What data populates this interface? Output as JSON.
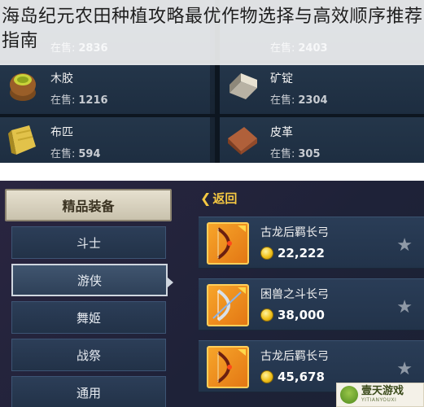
{
  "article": {
    "title": "海岛纪元农田种植攻略最优作物选择与高效顺序推荐指南"
  },
  "materials": {
    "stock_label": "在售:",
    "items": [
      {
        "name": "",
        "stock": "2836",
        "icon": "material-icon"
      },
      {
        "name": "",
        "stock": "2403",
        "icon": "material-icon"
      },
      {
        "name": "木胶",
        "stock": "1216",
        "icon": "wood-glue-icon"
      },
      {
        "name": "矿锭",
        "stock": "2304",
        "icon": "ore-ingot-icon"
      },
      {
        "name": "布匹",
        "stock": "594",
        "icon": "cloth-icon"
      },
      {
        "name": "皮革",
        "stock": "305",
        "icon": "leather-icon"
      }
    ]
  },
  "shop": {
    "category_header": "精品装备",
    "categories": [
      "斗士",
      "游侠",
      "舞姬",
      "战祭",
      "通用"
    ],
    "active_category": "游侠",
    "back_label": "返回",
    "items": [
      {
        "name": "古龙后羁长弓",
        "price": "22,222"
      },
      {
        "name": "困兽之斗长弓",
        "price": "38,000"
      },
      {
        "name": "古龙后羁长弓",
        "price": "45,678"
      }
    ]
  },
  "watermark": {
    "name": "壹天游戏",
    "sub": "YITIANYOUXI"
  },
  "colors": {
    "accent_gold": "#f5c842",
    "panel_blue": "#22334a",
    "icon_orange": "#f7a52a"
  }
}
